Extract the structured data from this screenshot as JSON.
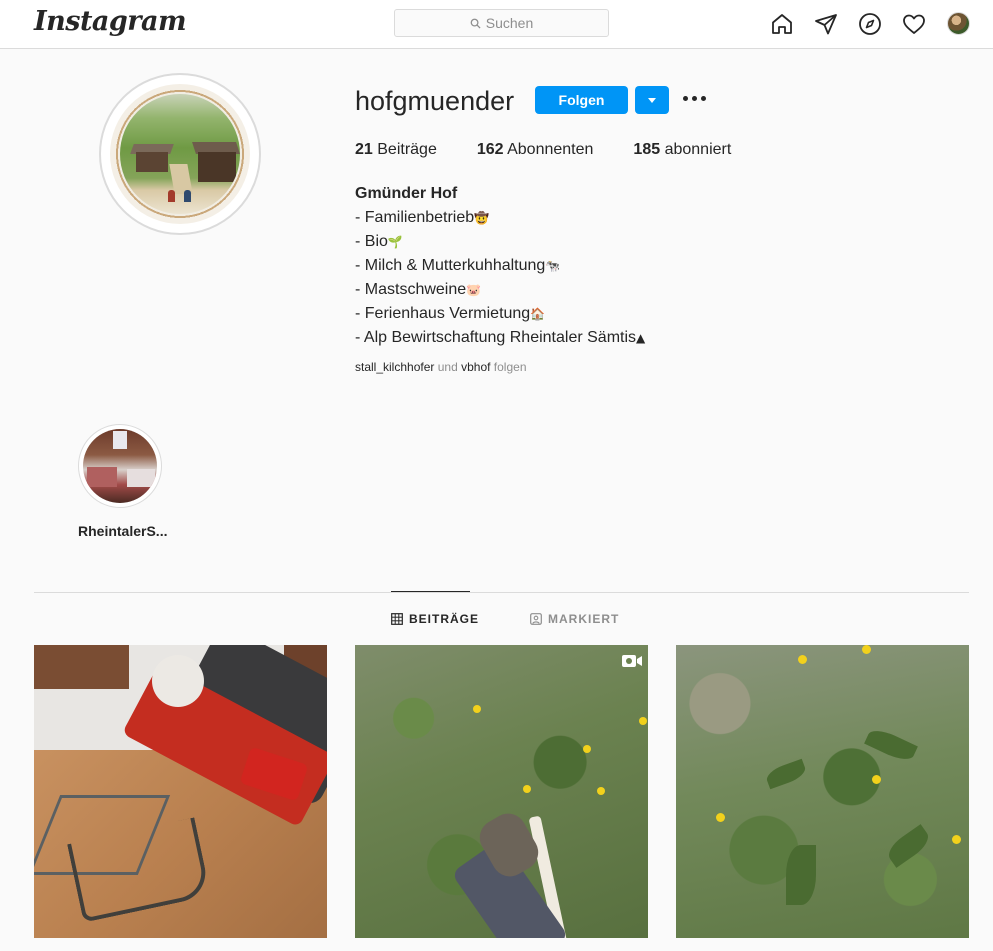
{
  "header": {
    "logo": "Instagram",
    "search_placeholder": "Suchen",
    "nav_icons": [
      "home-icon",
      "direct-icon",
      "explore-icon",
      "activity-icon",
      "avatar"
    ]
  },
  "profile": {
    "username": "hofgmuender",
    "follow_label": "Folgen",
    "stats": [
      {
        "count": "21",
        "label": "Beiträge"
      },
      {
        "count": "162",
        "label": "Abonnenten"
      },
      {
        "count": "185",
        "label": "abonniert"
      }
    ],
    "bio_name": "Gmünder Hof",
    "bio_lines": [
      {
        "text": "- Familienbetrieb",
        "emoji": "🤠"
      },
      {
        "text": "- Bio",
        "emoji": "🌱"
      },
      {
        "text": "- Milch & Mutterkuhhaltung",
        "emoji": "🐄"
      },
      {
        "text": "- Mastschweine",
        "emoji": "🐷"
      },
      {
        "text": "- Ferienhaus Vermietung",
        "emoji": "🏠"
      },
      {
        "text": "- Alp Bewirtschaftung Rheintaler Sämtis",
        "emoji": "▲"
      }
    ],
    "followed_by": {
      "account1": "stall_kilchhofer",
      "connector": "und",
      "account2": "vbhof",
      "suffix": "folgen"
    }
  },
  "highlights": [
    {
      "label": "RheintalerS..."
    }
  ],
  "tabs": {
    "posts": "BEITRÄGE",
    "tagged": "MARKIERT"
  },
  "colors": {
    "accent": "#0095f6",
    "border": "#dbdbdb",
    "background": "#fafafa",
    "text": "#262626",
    "muted": "#8e8e8e"
  }
}
